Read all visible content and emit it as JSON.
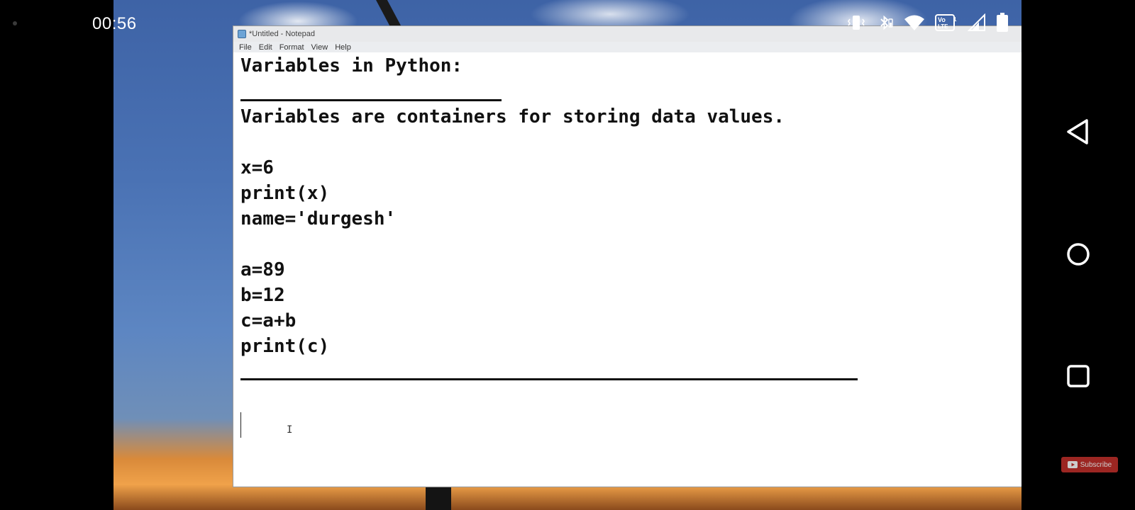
{
  "status_bar": {
    "time": "00:56",
    "icons": [
      "vibrate-icon",
      "bluetooth-icon",
      "wifi-icon",
      "volte-icon",
      "signal-icon",
      "battery-icon"
    ],
    "volte_label": "VoLTE1"
  },
  "notepad": {
    "title": "*Untitled - Notepad",
    "menu": {
      "file": "File",
      "edit": "Edit",
      "format": "Format",
      "view": "View",
      "help": "Help"
    },
    "lines": {
      "heading": "Variables in Python:",
      "definition": "Variables are containers for storing data values.",
      "code1": "x=6",
      "code2": "print(x)",
      "code3": "name='durgesh'",
      "code4": "a=89",
      "code5": "b=12",
      "code6": "c=a+b",
      "code7": "print(c)"
    }
  },
  "nav_bar": {
    "buttons": [
      "back-icon",
      "home-icon",
      "recents-icon"
    ]
  },
  "subscribe": {
    "label": "Subscribe"
  },
  "colors": {
    "subscribe": "#c4302b",
    "text": "#111111",
    "editor_bg": "#ffffff"
  }
}
